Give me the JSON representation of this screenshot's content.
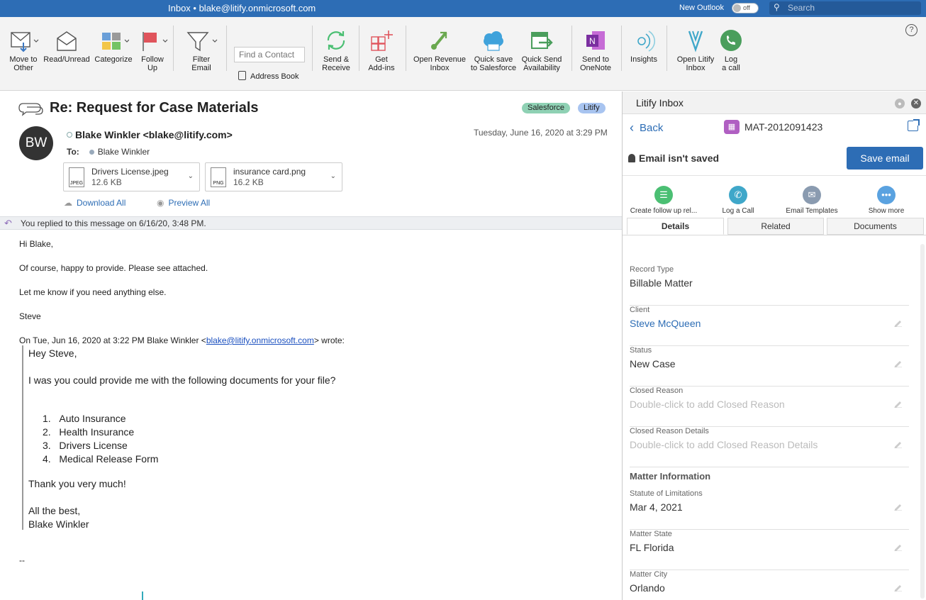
{
  "window": {
    "title": "Inbox • blake@litify.onmicrosoft.com",
    "new_outlook_label": "New Outlook",
    "toggle_state": "off",
    "search_placeholder": "Search"
  },
  "ribbon": {
    "buttons": [
      {
        "id": "move",
        "label": "Move to\nOther"
      },
      {
        "id": "readunread",
        "label": "Read/Unread"
      },
      {
        "id": "categorize",
        "label": "Categorize"
      },
      {
        "id": "followup",
        "label": "Follow\nUp"
      },
      {
        "id": "filter",
        "label": "Filter\nEmail"
      },
      {
        "id": "sendreceive",
        "label": "Send &\nReceive"
      },
      {
        "id": "addins",
        "label": "Get\nAdd-ins"
      },
      {
        "id": "revenue",
        "label": "Open Revenue\nInbox"
      },
      {
        "id": "quicksave",
        "label": "Quick save\nto Salesforce"
      },
      {
        "id": "quicksend",
        "label": "Quick Send\nAvailability"
      },
      {
        "id": "onenote",
        "label": "Send to\nOneNote"
      },
      {
        "id": "insights",
        "label": "Insights"
      },
      {
        "id": "openlitify",
        "label": "Open Litify\nInbox"
      },
      {
        "id": "logcall",
        "label": "Log\na call"
      }
    ],
    "find_contact_placeholder": "Find a Contact",
    "address_book": "Address Book"
  },
  "message": {
    "subject": "Re: Request for Case Materials",
    "tags": [
      "Salesforce",
      "Litify"
    ],
    "avatar_initials": "BW",
    "from": "Blake Winkler <blake@litify.com>",
    "date": "Tuesday, June 16, 2020 at 3:29 PM",
    "to_label": "To:",
    "to": "Blake Winkler",
    "attachments": [
      {
        "name": "Drivers License.jpeg",
        "size": "12.6 KB",
        "type": "JPEG"
      },
      {
        "name": "insurance card.png",
        "size": "16.2 KB",
        "type": "PNG"
      }
    ],
    "download_all": "Download All",
    "preview_all": "Preview All",
    "replied_notice": "You replied to this message on 6/16/20, 3:48 PM.",
    "body": [
      "Hi Blake,",
      "Of course, happy to provide. Please see attached.",
      "Let me know if you need anything else.",
      "Steve"
    ],
    "wrote_prefix": "On Tue, Jun 16, 2020 at 3:22 PM Blake Winkler <",
    "wrote_email": "blake@litify.onmicrosoft.com",
    "wrote_suffix": "> wrote:",
    "quoted": {
      "greeting": "Hey Steve,",
      "line1": "I was you could provide me with the following documents for your file?",
      "list": [
        "Auto Insurance",
        "Health Insurance",
        "Drivers License",
        "Medical Release Form"
      ],
      "thanks": "Thank you very much!",
      "signoff1": "All the best,",
      "signoff2": "Blake Winkler"
    },
    "sig_sep": "--"
  },
  "pane": {
    "title": "Litify Inbox",
    "back": "Back",
    "matter_id": "MAT-2012091423",
    "status_text": "Email isn't saved",
    "save_button": "Save email",
    "actions": [
      {
        "label": "Create follow up rel...",
        "color": "#4bbf73"
      },
      {
        "label": "Log a Call",
        "color": "#3fa7c9"
      },
      {
        "label": "Email Templates",
        "color": "#8a9bb0"
      },
      {
        "label": "Show more",
        "color": "#5aa2e0"
      }
    ],
    "tabs": [
      "Details",
      "Related",
      "Documents"
    ],
    "fields": [
      {
        "label": "Record Type",
        "value": "Billable Matter",
        "style": "plain",
        "edit": false
      },
      {
        "label": "Client",
        "value": "Steve McQueen",
        "style": "link",
        "edit": true
      },
      {
        "label": "Status",
        "value": "New Case",
        "style": "plain",
        "edit": true
      },
      {
        "label": "Closed Reason",
        "value": "Double-click to add Closed Reason",
        "style": "ph",
        "edit": true
      },
      {
        "label": "Closed Reason Details",
        "value": "Double-click to add Closed Reason Details",
        "style": "ph",
        "edit": true
      }
    ],
    "section": "Matter Information",
    "fields2": [
      {
        "label": "Statute of Limitations",
        "value": "Mar 4, 2021",
        "style": "plain",
        "edit": true
      },
      {
        "label": "Matter State",
        "value": "FL Florida",
        "style": "plain",
        "edit": true
      },
      {
        "label": "Matter City",
        "value": "Orlando",
        "style": "plain",
        "edit": true
      }
    ]
  }
}
